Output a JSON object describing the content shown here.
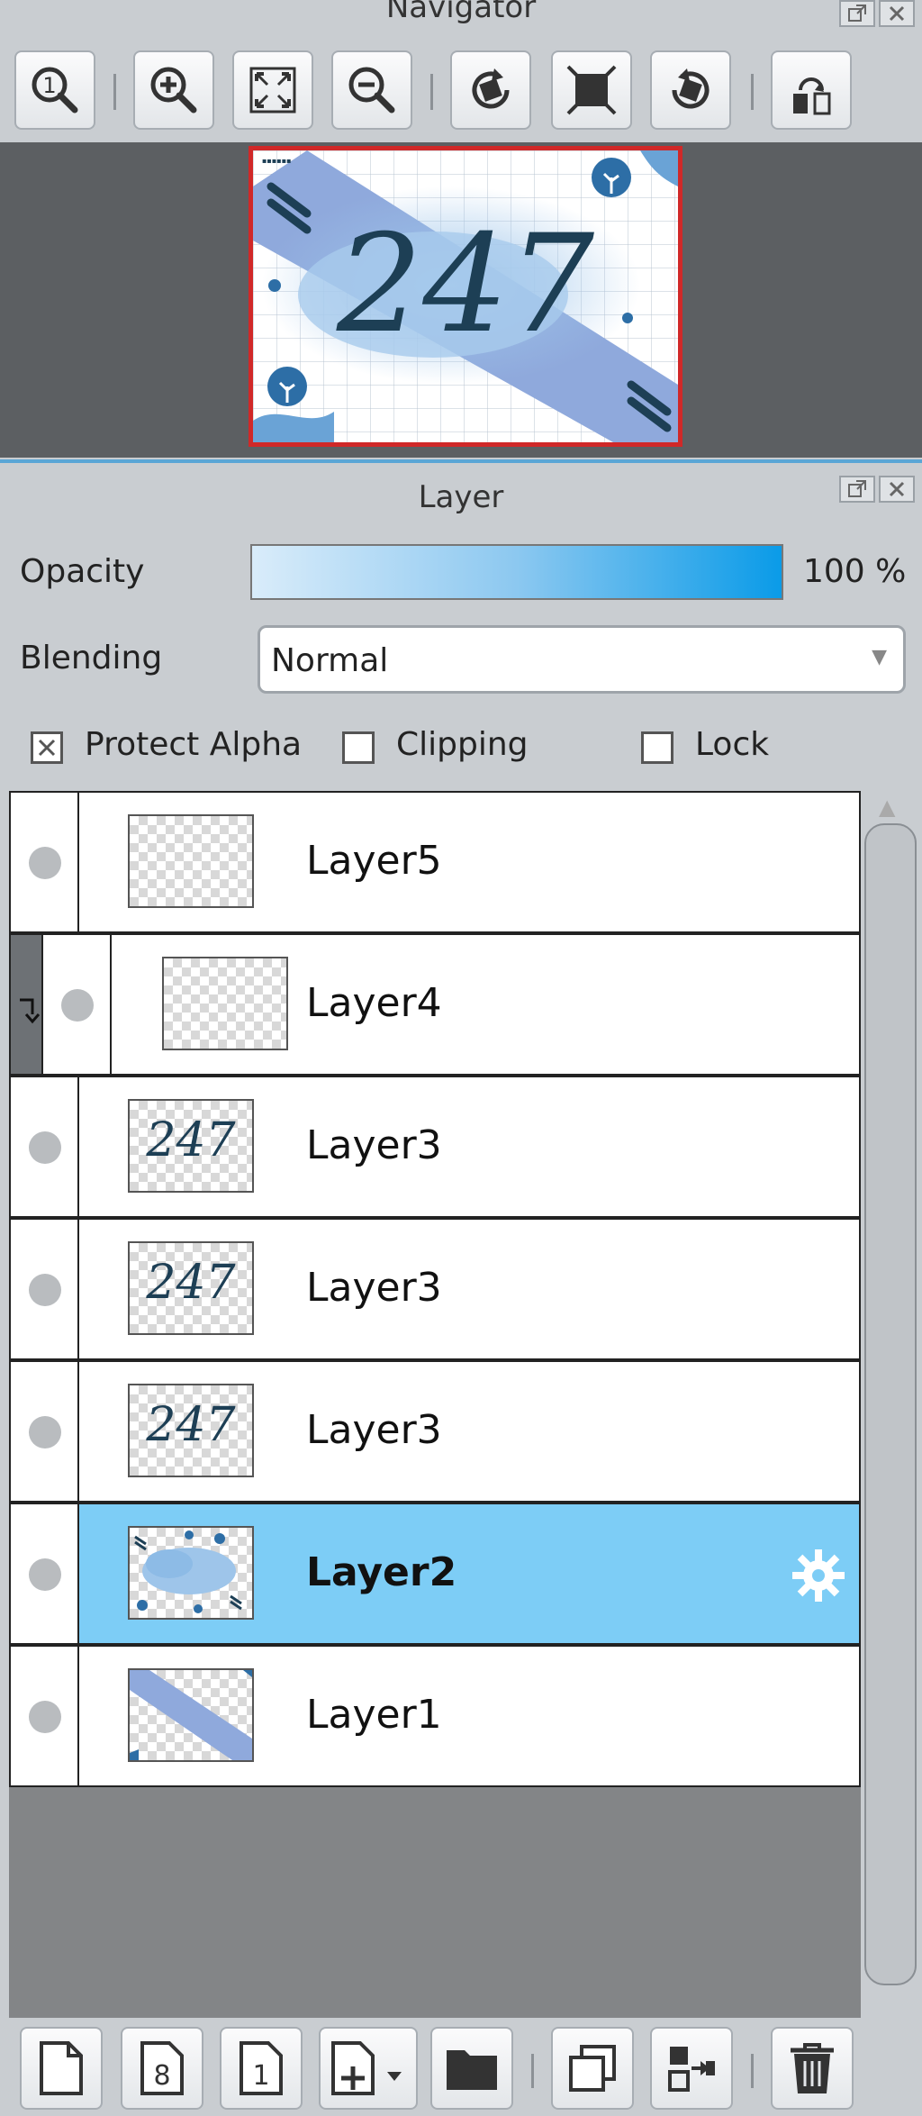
{
  "navigator": {
    "title": "Navigator",
    "toolbar": [
      {
        "icon": "zoom-actual-size-icon"
      },
      {
        "icon": "zoom-in-icon"
      },
      {
        "icon": "fit-to-window-icon"
      },
      {
        "icon": "zoom-out-icon"
      },
      {
        "icon": "rotate-left-icon"
      },
      {
        "icon": "reset-view-icon"
      },
      {
        "icon": "rotate-right-icon"
      },
      {
        "icon": "flip-horizontal-icon"
      }
    ],
    "preview": {
      "big_text": "247",
      "frame_color": "#d02828"
    }
  },
  "layer_panel": {
    "title": "Layer",
    "opacity_label": "Opacity",
    "opacity_value": "100 %",
    "opacity_fraction": 1.0,
    "blending_label": "Blending",
    "blending_value": "Normal",
    "protect_alpha_label": "Protect Alpha",
    "protect_alpha_checked": true,
    "clipping_label": "Clipping",
    "clipping_checked": false,
    "lock_label": "Lock",
    "lock_checked": false,
    "selected_color": "#7dcdf6",
    "layers": [
      {
        "name": "Layer5",
        "thumb": "empty",
        "clipped": false,
        "selected": false
      },
      {
        "name": "Layer4",
        "thumb": "empty",
        "clipped": true,
        "selected": false
      },
      {
        "name": "Layer3",
        "thumb": "247",
        "clipped": false,
        "selected": false
      },
      {
        "name": "Layer3",
        "thumb": "247",
        "clipped": false,
        "selected": false
      },
      {
        "name": "Layer3",
        "thumb": "247",
        "clipped": false,
        "selected": false
      },
      {
        "name": "Layer2",
        "thumb": "cloud",
        "clipped": false,
        "selected": true
      },
      {
        "name": "Layer1",
        "thumb": "stripe",
        "clipped": false,
        "selected": false
      }
    ],
    "thumb_text": "247"
  },
  "bottom_toolbar": [
    {
      "icon": "new-layer-icon"
    },
    {
      "icon": "new-8bit-layer-icon",
      "glyph": "8"
    },
    {
      "icon": "new-1bit-layer-icon",
      "glyph": "1"
    },
    {
      "icon": "add-layer-dropdown-icon"
    },
    {
      "icon": "new-folder-icon"
    },
    {
      "icon": "duplicate-layer-icon"
    },
    {
      "icon": "merge-down-icon"
    },
    {
      "icon": "delete-layer-icon"
    }
  ]
}
